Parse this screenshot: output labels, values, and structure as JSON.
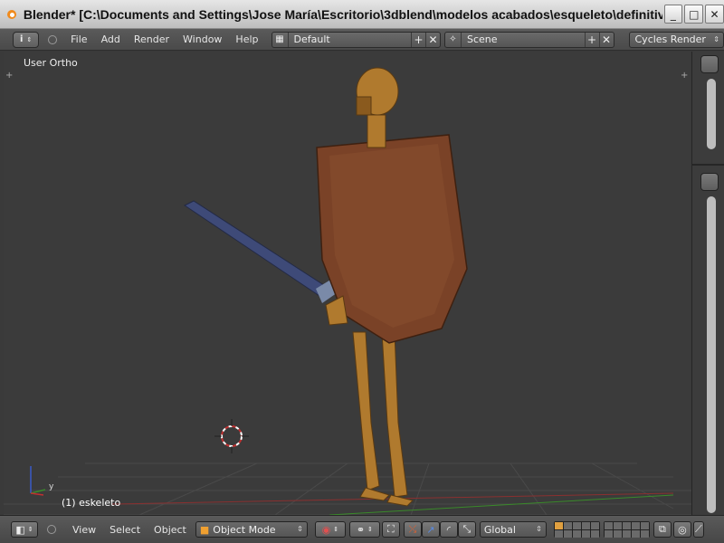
{
  "window": {
    "title": "Blender* [C:\\Documents and Settings\\Jose María\\Escritorio\\3dblend\\modelos acabados\\esqueleto\\definitivos\\b...",
    "minimize_glyph": "_",
    "maximize_glyph": "□",
    "close_glyph": "✕"
  },
  "info_header": {
    "editor_icon": "i",
    "menus": [
      "File",
      "Add",
      "Render",
      "Window",
      "Help"
    ],
    "layout_name": "Default",
    "scene_name": "Scene",
    "render_engine": "Cycles Render",
    "add_glyph": "+",
    "remove_glyph": "✕"
  },
  "viewport": {
    "view_label": "User Ortho",
    "object_label": "(1) eskeleto",
    "axis_y_label": "y",
    "corner_plus": "+"
  },
  "bottom_header": {
    "menus": [
      "View",
      "Select",
      "Object"
    ],
    "mode": "Object Mode",
    "orientation": "Global"
  },
  "colors": {
    "viewport_bg": "#3b3b3b",
    "header_bg": "#4e4e4e",
    "shield": "#7a4227",
    "bone": "#b07a2e",
    "sword": "#3e4a78",
    "grid_red": "#8a3030",
    "grid_green": "#3a8a2a",
    "cursor": "#ffffff"
  }
}
